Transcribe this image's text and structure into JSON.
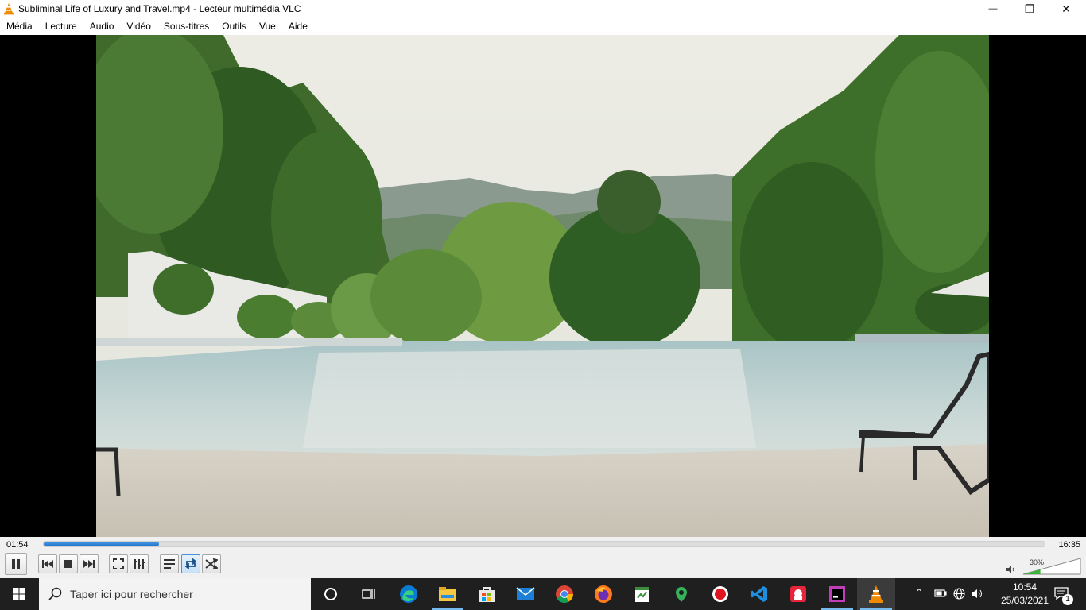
{
  "window": {
    "title": "Subliminal Life of Luxury and Travel.mp4 - Lecteur multimédia VLC",
    "minimize_glyph": "—",
    "maximize_glyph": "❐",
    "close_glyph": "✕"
  },
  "menu": {
    "items": [
      "Média",
      "Lecture",
      "Audio",
      "Vidéo",
      "Sous-titres",
      "Outils",
      "Vue",
      "Aide"
    ]
  },
  "playback": {
    "elapsed": "01:54",
    "total": "16:35",
    "progress_fraction": 0.115,
    "volume_label": "30%",
    "volume_fraction": 0.3,
    "loop_active": true
  },
  "taskbar": {
    "search_placeholder": "Taper ici pour rechercher",
    "clock_time": "10:54",
    "clock_date": "25/03/2021",
    "notification_count": "1",
    "apps": [
      "cortana-icon",
      "task-view-icon",
      "edge-icon",
      "file-explorer-icon",
      "store-icon",
      "mail-icon",
      "chrome-icon",
      "firefox-icon",
      "notepad-icon",
      "maps-icon",
      "recorder-icon",
      "vscode-icon",
      "gitkraken-icon",
      "webstorm-icon",
      "vlc-icon"
    ]
  },
  "colors": {
    "accent": "#1a6fc7",
    "vlc_orange": "#f08a00",
    "taskbar": "#1f1f1f"
  }
}
